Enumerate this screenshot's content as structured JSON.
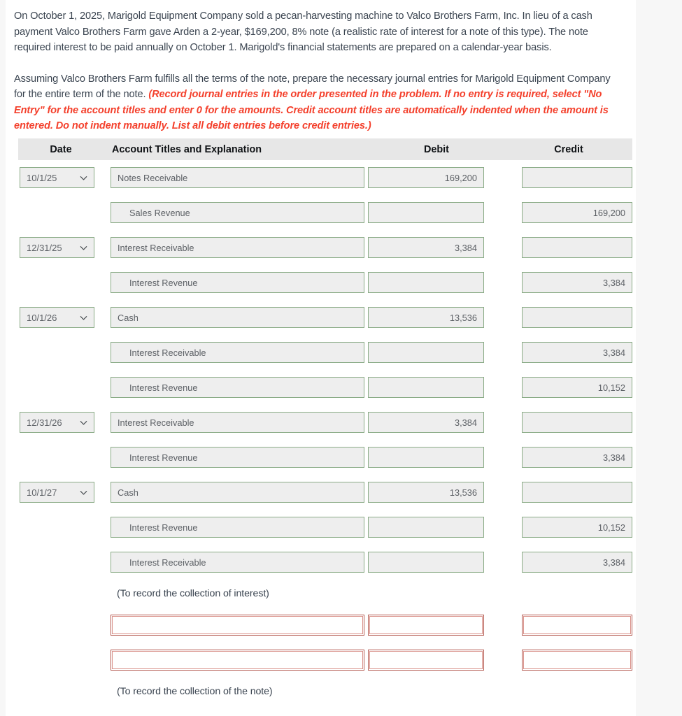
{
  "problem": {
    "paragraph1": "On October 1, 2025, Marigold Equipment Company sold a pecan-harvesting machine to Valco Brothers Farm, Inc. In lieu of a cash payment Valco Brothers Farm gave Arden a 2-year, $169,200, 8% note (a realistic rate of interest for a note of this type). The note required interest to be paid annually on October 1. Marigold's financial statements are prepared on a calendar-year basis.",
    "paragraph2_lead": "Assuming Valco Brothers Farm fulfills all the terms of the note, prepare the necessary journal entries for Marigold Equipment Company for the entire term of the note. ",
    "paragraph2_instruction": "(Record journal entries in the order presented in the problem. If no entry is required, select \"No Entry\" for the account titles and enter 0 for the amounts. Credit account titles are automatically indented when the amount is entered. Do not indent manually. List all debit entries before credit entries.)"
  },
  "table": {
    "headers": {
      "date": "Date",
      "account": "Account Titles and Explanation",
      "debit": "Debit",
      "credit": "Credit"
    },
    "rows": [
      {
        "date": "10/1/25",
        "account": "Notes Receivable",
        "indent": false,
        "debit": "169,200",
        "credit": "",
        "state": "filled"
      },
      {
        "date": "",
        "account": "Sales Revenue",
        "indent": true,
        "debit": "",
        "credit": "169,200",
        "state": "filled"
      },
      {
        "date": "12/31/25",
        "account": "Interest Receivable",
        "indent": false,
        "debit": "3,384",
        "credit": "",
        "state": "filled"
      },
      {
        "date": "",
        "account": "Interest Revenue",
        "indent": true,
        "debit": "",
        "credit": "3,384",
        "state": "filled"
      },
      {
        "date": "10/1/26",
        "account": "Cash",
        "indent": false,
        "debit": "13,536",
        "credit": "",
        "state": "filled"
      },
      {
        "date": "",
        "account": "Interest Receivable",
        "indent": true,
        "debit": "",
        "credit": "3,384",
        "state": "filled"
      },
      {
        "date": "",
        "account": "Interest Revenue",
        "indent": true,
        "debit": "",
        "credit": "10,152",
        "state": "filled"
      },
      {
        "date": "12/31/26",
        "account": "Interest Receivable",
        "indent": false,
        "debit": "3,384",
        "credit": "",
        "state": "filled"
      },
      {
        "date": "",
        "account": "Interest Revenue",
        "indent": true,
        "debit": "",
        "credit": "3,384",
        "state": "filled"
      },
      {
        "date": "10/1/27",
        "account": "Cash",
        "indent": false,
        "debit": "13,536",
        "credit": "",
        "state": "filled"
      },
      {
        "date": "",
        "account": "Interest Revenue",
        "indent": true,
        "debit": "",
        "credit": "10,152",
        "state": "filled"
      },
      {
        "date": "",
        "account": "Interest Receivable",
        "indent": true,
        "debit": "",
        "credit": "3,384",
        "state": "filled"
      }
    ],
    "caption1": "(To record the collection of interest)",
    "empty_rows": [
      {
        "date": "",
        "account": "",
        "indent": false,
        "debit": "",
        "credit": "",
        "state": "empty"
      },
      {
        "date": "",
        "account": "",
        "indent": false,
        "debit": "",
        "credit": "",
        "state": "empty"
      }
    ],
    "caption2": "(To record the collection of the note)"
  },
  "icons": {
    "dropdown": "chevron-down-icon"
  },
  "colors": {
    "field_border_filled": "#8aab86",
    "field_border_empty": "#b45b52",
    "field_fill_filled": "#eeeeee",
    "header_band": "#e7e7e7",
    "body_text": "#3a4450",
    "instruction_text": "#f4402c",
    "page_background": "#f7f7f7"
  }
}
